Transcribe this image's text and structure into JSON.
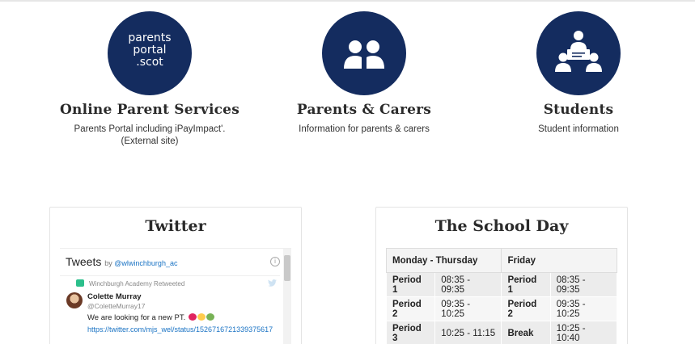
{
  "features": [
    {
      "title": "Online Parent Services",
      "desc1": "Parents Portal including iPayImpact'.",
      "desc2": "(External site)",
      "logo_lines": [
        "parents",
        "portal",
        ".scot"
      ]
    },
    {
      "title": "Parents & Carers",
      "desc1": "Information for parents & carers",
      "icon": "parents-icon"
    },
    {
      "title": "Students",
      "desc1": "Student information",
      "icon": "students-icon"
    }
  ],
  "twitter": {
    "title": "Twitter",
    "tweets_label": "Tweets",
    "by_label": "by",
    "account": "@wlwinchburgh_ac",
    "retweet_text": "Winchburgh Academy Retweeted",
    "name": "Colette Murray",
    "handle": "@ColetteMurray17",
    "text": "We are looking for a new PT.",
    "link": "https://twitter.com/mjs_wel/status/1526716721339375617"
  },
  "school_day": {
    "title": "The School Day",
    "headers": [
      "Monday - Thursday",
      "Friday"
    ],
    "rows": [
      [
        "Period 1",
        "08:35 - 09:35",
        "Period 1",
        "08:35 - 09:35"
      ],
      [
        "Period 2",
        "09:35 - 10:25",
        "Period 2",
        "09:35 - 10:25"
      ],
      [
        "Period 3",
        "10:25 - 11:15",
        "Break",
        "10:25 - 10:40"
      ]
    ]
  },
  "colors": {
    "navy": "#142c5f",
    "heart_red": "#e0245e",
    "heart_yellow": "#ffcc4d",
    "heart_green": "#77b255"
  }
}
